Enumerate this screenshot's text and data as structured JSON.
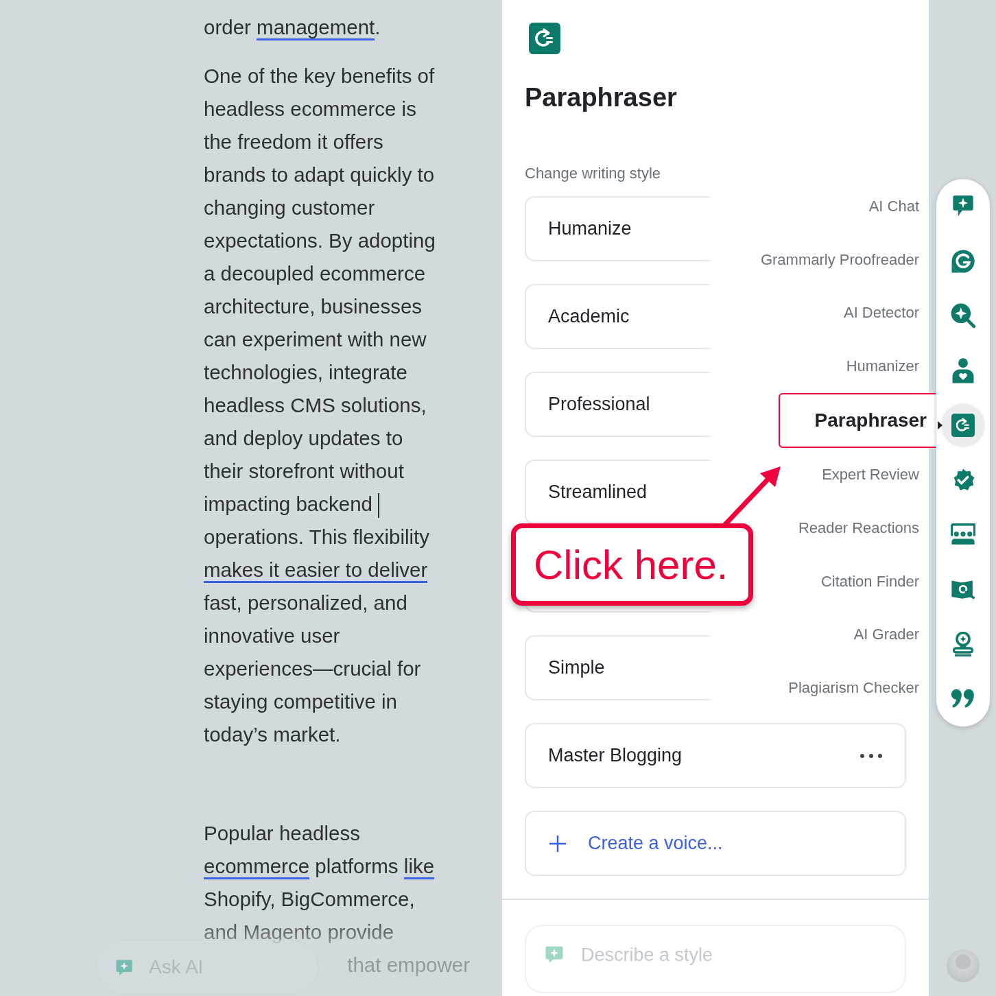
{
  "document": {
    "paragraphs": [
      {
        "lines": [
          [
            {
              "text": "order "
            },
            {
              "text": "management",
              "underlined": true
            },
            {
              "text": "."
            }
          ]
        ]
      },
      {
        "lines": [
          [
            {
              "text": "One of the key benefits of"
            }
          ],
          [
            {
              "text": "headless ecommerce is"
            }
          ],
          [
            {
              "text": "the freedom it offers"
            }
          ],
          [
            {
              "text": "brands to adapt quickly to"
            }
          ],
          [
            {
              "text": "changing customer"
            }
          ],
          [
            {
              "text": "expectations. By adopting"
            }
          ],
          [
            {
              "text": "a decoupled ecommerce"
            }
          ],
          [
            {
              "text": "architecture, businesses"
            }
          ],
          [
            {
              "text": "can experiment with new"
            }
          ],
          [
            {
              "text": "technologies, integrate"
            }
          ],
          [
            {
              "text": "headless CMS solutions,"
            }
          ],
          [
            {
              "text": "and deploy updates to"
            }
          ],
          [
            {
              "text": "their storefront without"
            }
          ],
          [
            {
              "text": "impacting backend",
              "caret": true
            }
          ],
          [
            {
              "text": "operations. This flexibility"
            }
          ],
          [
            {
              "text": "makes it easier to deliver",
              "underlined": true
            }
          ],
          [
            {
              "text": "fast, personalized, and"
            }
          ],
          [
            {
              "text": "innovative user"
            }
          ],
          [
            {
              "text": "experiences—crucial for"
            }
          ],
          [
            {
              "text": "staying competitive in"
            }
          ],
          [
            {
              "text": "today’s market."
            }
          ]
        ]
      },
      {
        "lines": [
          [
            {
              "text": "Popular headless"
            }
          ],
          [
            {
              "text": "ecommerce",
              "underlined": true
            },
            {
              "text": " platforms "
            },
            {
              "text": "like",
              "underlined": true
            }
          ],
          [
            {
              "text": "Shopify, BigCommerce,"
            }
          ],
          [
            {
              "text": "and Magento provide"
            }
          ],
          [
            {
              "text": "that empower"
            }
          ]
        ]
      }
    ]
  },
  "ask_ai": {
    "label": "Ask AI"
  },
  "panel": {
    "title": "Paraphraser",
    "section_label": "Change writing style",
    "styles": [
      {
        "kind": "style",
        "label": "Humanize"
      },
      {
        "kind": "style",
        "label": "Academic"
      },
      {
        "kind": "style",
        "label": "Professional"
      },
      {
        "kind": "style",
        "label": "Streamlined"
      },
      {
        "kind": "covered"
      },
      {
        "kind": "style",
        "label": "Simple"
      },
      {
        "kind": "custom",
        "label": "Master Blogging"
      },
      {
        "kind": "create",
        "label": "Create a voice..."
      }
    ],
    "describe_field": {
      "placeholder": "Describe a style"
    }
  },
  "annotation": {
    "text": "Click here."
  },
  "tools": [
    {
      "kind": "chat",
      "label": "AI Chat",
      "selected": false
    },
    {
      "kind": "proofreader",
      "label": "Grammarly Proofreader",
      "selected": false
    },
    {
      "kind": "detector",
      "label": "AI Detector",
      "selected": false
    },
    {
      "kind": "humanizer",
      "label": "Humanizer",
      "selected": false
    },
    {
      "kind": "paraphraser",
      "label": "Paraphraser",
      "selected": true
    },
    {
      "kind": "review",
      "label": "Expert Review",
      "selected": false
    },
    {
      "kind": "reactions",
      "label": "Reader Reactions",
      "selected": false
    },
    {
      "kind": "citation",
      "label": "Citation Finder",
      "selected": false
    },
    {
      "kind": "grader",
      "label": "AI Grader",
      "selected": false
    },
    {
      "kind": "plagiarism",
      "label": "Plagiarism Checker",
      "selected": false
    }
  ]
}
